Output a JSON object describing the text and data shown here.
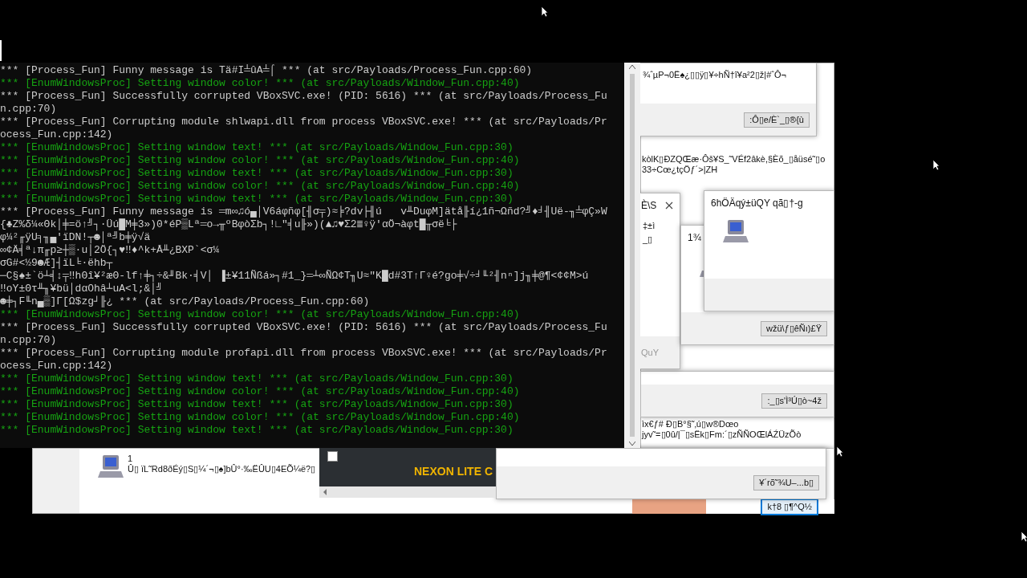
{
  "windows": [
    {
      "kind": "dialog",
      "lines": [
        "¾ˆµP¬0Ë♠¿▯▯ÿ▯¥÷hÑ†î¥a²2▯ž|#ˆÔ¬"
      ],
      "button": ":Ô▯e/È`_▯®{ù"
    },
    {
      "kind": "text",
      "lines": [
        "kòlK▯ÐZQŒæ·Ôš¥S_˜VÉf2âkè,§Èõ_▯åüsé˜▯o",
        "33÷Cœ¿tçÖƒ´>|ZH"
      ]
    },
    {
      "kind": "message",
      "title": "6hÖÄqý±üQY  qã▯†-g",
      "close": false,
      "has_icon": true
    },
    {
      "kind": "message",
      "title": "1¾",
      "close": false,
      "has_icon": true,
      "button": "wžü\\ƒ▯êÑı)£Ÿ"
    },
    {
      "kind": "message",
      "title": "È\\S",
      "close": true,
      "has_icon": false,
      "lines": [
        "‡±ì",
        "_▯"
      ],
      "footer_text": "QuY"
    },
    {
      "kind": "dialog",
      "button": ":_▯s'Ì³Ú▯ò~4ž"
    },
    {
      "kind": "text",
      "lines": [
        "ìx€ƒ#        Ð▯B°§˜‚ú▯w®Dœo",
        "jyv˜=▯0û/|¯▯sËk▯Fm:´▯zÑÑOŒlÁŹÜzÕò"
      ]
    },
    {
      "kind": "launcher",
      "checked": false,
      "label": "NEXON LITE C"
    },
    {
      "kind": "dialog",
      "button": "¥´rõ˜¾U–...b▯"
    },
    {
      "kind": "strip",
      "button": "k†8 ▯¶^Q½"
    },
    {
      "kind": "list",
      "lines": [
        "1",
        "Û▯ ïL˜Rd8ðÉý▯S▯¼´¬▯♠]bÛ°·‰ËÛU▯4EÕ¼ë?▯"
      ]
    },
    {
      "kind": "backdrop"
    }
  ],
  "console": {
    "lines": [
      {
        "kind": "info",
        "text": "*** [Process_Fun] Funny message is Tä#I╧ûA╧⌠ *** (at src/Payloads/Process_Fun.cpp:60)"
      },
      {
        "kind": "window",
        "text": "*** [EnumWindowsProc] Setting window color! *** (at src/Payloads/Window_Fun.cpp:40)"
      },
      {
        "kind": "info",
        "text": "*** [Process_Fun] Successfully corrupted VBoxSVC.exe! (PID: 5616) *** (at src/Payloads/Process_Fu"
      },
      {
        "kind": "info",
        "text": "n.cpp:70)"
      },
      {
        "kind": "info",
        "text": "*** [Process_Fun] Corrupting module shlwapi.dll from process VBoxSVC.exe! *** (at src/Payloads/Pr"
      },
      {
        "kind": "info",
        "text": "ocess_Fun.cpp:142)"
      },
      {
        "kind": "window",
        "text": "*** [EnumWindowsProc] Setting window text! *** (at src/Payloads/Window_Fun.cpp:30)"
      },
      {
        "kind": "window",
        "text": "*** [EnumWindowsProc] Setting window color! *** (at src/Payloads/Window_Fun.cpp:40)"
      },
      {
        "kind": "window",
        "text": "*** [EnumWindowsProc] Setting window text! *** (at src/Payloads/Window_Fun.cpp:30)"
      },
      {
        "kind": "window",
        "text": "*** [EnumWindowsProc] Setting window color! *** (at src/Payloads/Window_Fun.cpp:40)"
      },
      {
        "kind": "window",
        "text": "*** [EnumWindowsProc] Setting window text! *** (at src/Payloads/Window_Fun.cpp:30)"
      },
      {
        "kind": "info",
        "text": "*** [Process_Fun] Funny message is ═m∞♫ó▄│V6áφñφ[╢σ╤)≈╞?dv├╢ú   v╨DuφM]ätå╟í¿1ñ¬Ωñd?╝♦╛╢Uë-╖╧φÇ»W"
      },
      {
        "kind": "info",
        "text": "{♣Z%δ¼«Θk│╪=ö↑╝┐·Üú█M╪3»)0*éP▒Lª═o→╥ºBφòΣb┐!∟\"╡u╟»)(▲♫♥Σ2≣♀ÿ'αÖ¬àφt█╥σë╘├"
      },
      {
        "kind": "info",
        "text": "φ¼²╓ÿU╕╖▄'ïDN!┬☻│ª╝b╪ÿ√ä"
      },
      {
        "kind": "info",
        "text": "∞¢Ä╡ª↓π╓p≥┼▒·u│2Ö{┐♥‼♦^k+Å╨¿BXP`<σ¼"
      },
      {
        "kind": "info",
        "text": "σG#<½9☻Æ]┤ïL╘·ëhb┬"
      },
      {
        "kind": "info",
        "text": "─C§♠±`ö┴╡↕╤‼hΘî¥²æΘ-lf↑╪┐÷&╜Bk·╡V│ ▐±¥11Ñßá»┐#1_}═┴∞ÑΩ¢T╖U≈\"K█d#3T↑Γ♀é?go╪√÷╛╙²╢nⁿ]j╖╪@¶<¢¢M>ú"
      },
      {
        "kind": "info",
        "text": "‼oY±Θτ╨╖¥bü│dαOhâ┴uA<l;&│╝"
      },
      {
        "kind": "info",
        "text": "☻╪┐F╙n▄▒]Γ[Ω$zg┘╟¿ *** (at src/Payloads/Process_Fun.cpp:60)"
      },
      {
        "kind": "window",
        "text": "*** [EnumWindowsProc] Setting window color! *** (at src/Payloads/Window_Fun.cpp:40)"
      },
      {
        "kind": "info",
        "text": "*** [Process_Fun] Successfully corrupted VBoxSVC.exe! (PID: 5616) *** (at src/Payloads/Process_Fu"
      },
      {
        "kind": "info",
        "text": "n.cpp:70)"
      },
      {
        "kind": "info",
        "text": "*** [Process_Fun] Corrupting module profapi.dll from process VBoxSVC.exe! *** (at src/Payloads/Pr"
      },
      {
        "kind": "info",
        "text": "ocess_Fun.cpp:142)"
      },
      {
        "kind": "window",
        "text": "*** [EnumWindowsProc] Setting window text! *** (at src/Payloads/Window_Fun.cpp:30)"
      },
      {
        "kind": "window",
        "text": "*** [EnumWindowsProc] Setting window color! *** (at src/Payloads/Window_Fun.cpp:40)"
      },
      {
        "kind": "window",
        "text": "*** [EnumWindowsProc] Setting window text! *** (at src/Payloads/Window_Fun.cpp:30)"
      },
      {
        "kind": "window",
        "text": "*** [EnumWindowsProc] Setting window color! *** (at src/Payloads/Window_Fun.cpp:40)"
      },
      {
        "kind": "window",
        "text": "*** [EnumWindowsProc] Setting window text! *** (at src/Payloads/Window_Fun.cpp:30)"
      }
    ]
  }
}
